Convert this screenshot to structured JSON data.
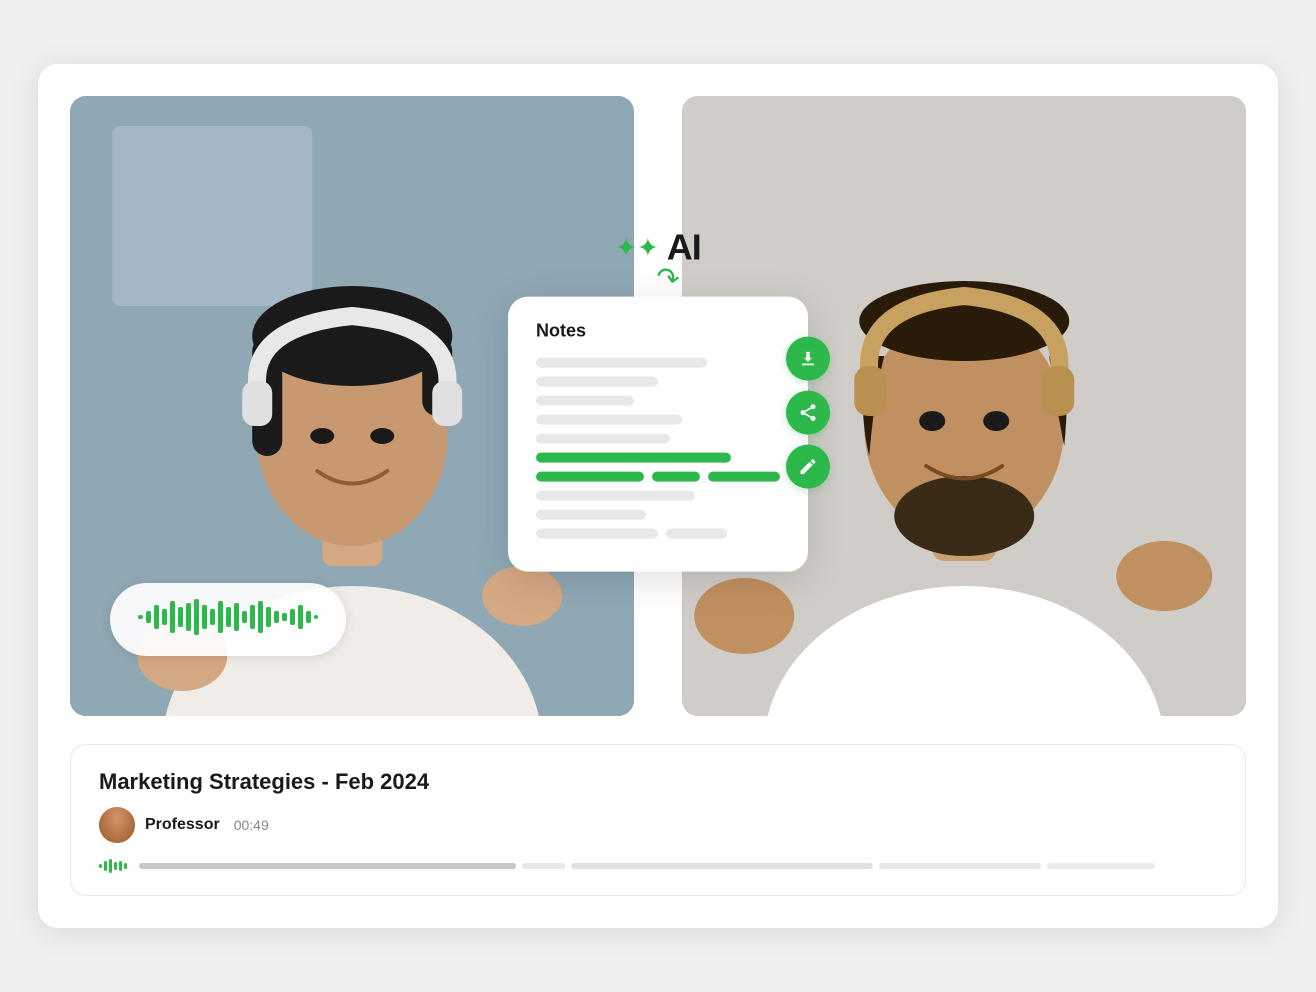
{
  "card": {
    "ai_label": "AI",
    "notes_title": "Notes",
    "recording_title": "Marketing Strategies - Feb 2024",
    "professor_name": "Professor",
    "timestamp": "00:49",
    "action_buttons": [
      {
        "id": "download",
        "label": "Download"
      },
      {
        "id": "share",
        "label": "Share"
      },
      {
        "id": "edit",
        "label": "Edit"
      }
    ],
    "note_lines": [
      {
        "width": "70%",
        "green": false
      },
      {
        "width": "50%",
        "green": false
      },
      {
        "width": "40%",
        "green": false
      },
      {
        "width": "60%",
        "green": false
      },
      {
        "width": "55%",
        "green": false
      },
      {
        "width": "100%",
        "green": true
      },
      {
        "width": "100%",
        "green": true,
        "multi": true
      },
      {
        "width": "65%",
        "green": false
      },
      {
        "width": "45%",
        "green": false
      },
      {
        "width": "50%",
        "green": false
      }
    ],
    "waveform_bars": [
      4,
      8,
      14,
      20,
      28,
      22,
      18,
      30,
      24,
      16,
      26,
      32,
      28,
      20,
      24,
      18,
      14,
      22,
      16,
      10,
      18,
      24,
      20,
      14,
      8
    ],
    "progress_mini_bars": [
      6,
      10,
      8,
      12,
      10,
      7
    ],
    "progress_segments": [
      {
        "width": "35%",
        "opacity": 1
      },
      {
        "width": "5%",
        "opacity": 0.3
      },
      {
        "width": "12%",
        "opacity": 0.3
      },
      {
        "width": "10%",
        "opacity": 0.3
      }
    ]
  }
}
